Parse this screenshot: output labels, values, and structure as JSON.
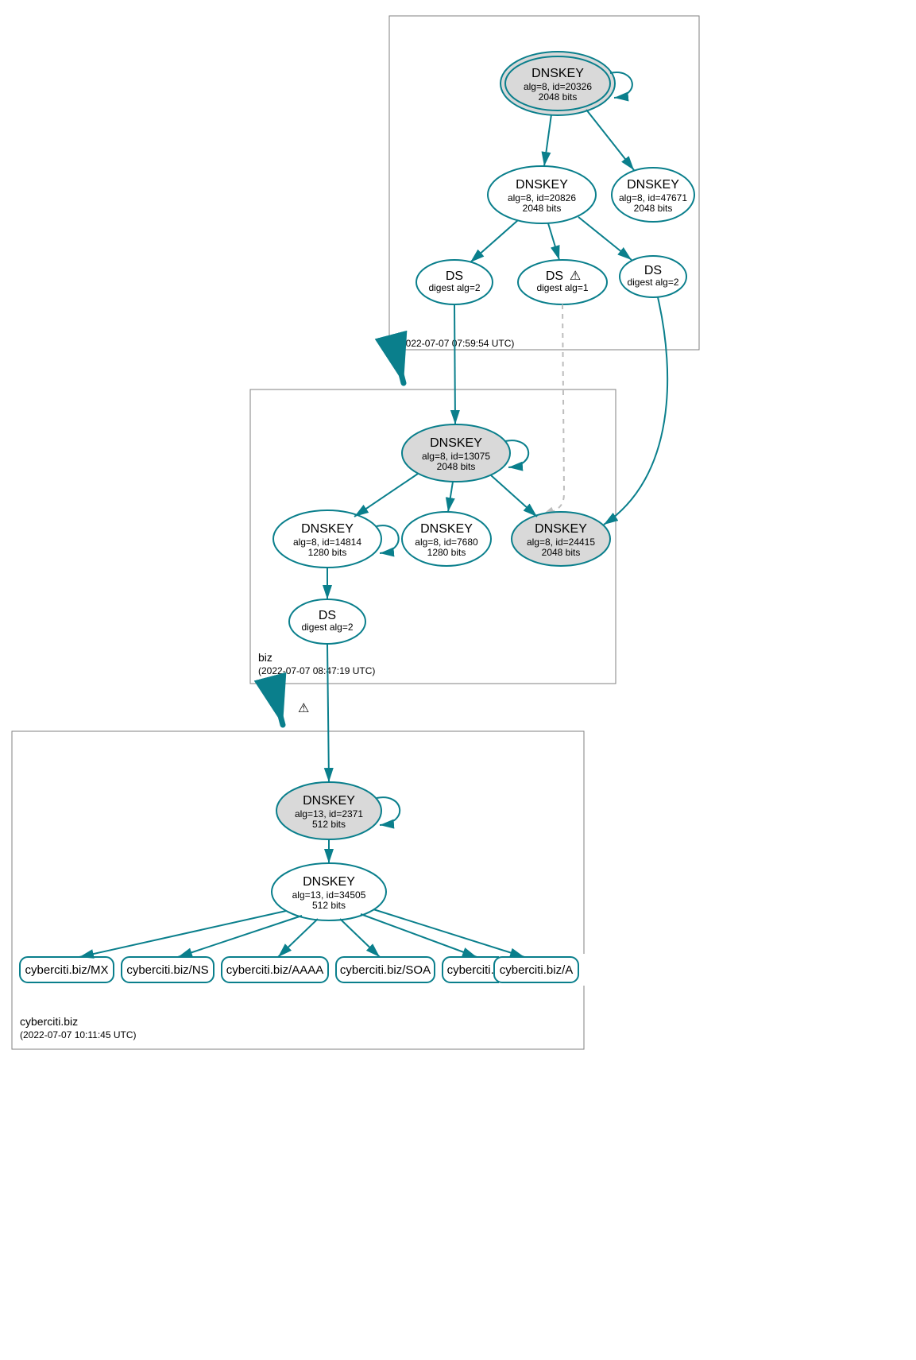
{
  "zones": {
    "root": {
      "name": ".",
      "timestamp": "(2022-07-07 07:59:54 UTC)"
    },
    "biz": {
      "name": "biz",
      "timestamp": "(2022-07-07 08:47:19 UTC)"
    },
    "cyberciti": {
      "name": "cyberciti.biz",
      "timestamp": "(2022-07-07 10:11:45 UTC)"
    }
  },
  "nodes": {
    "root_ksk": {
      "title": "DNSKEY",
      "line2": "alg=8, id=20326",
      "line3": "2048 bits"
    },
    "root_zsk1": {
      "title": "DNSKEY",
      "line2": "alg=8, id=20826",
      "line3": "2048 bits"
    },
    "root_zsk2": {
      "title": "DNSKEY",
      "line2": "alg=8, id=47671",
      "line3": "2048 bits"
    },
    "root_ds1": {
      "title": "DS",
      "line2": "digest alg=2",
      "line3": ""
    },
    "root_ds2": {
      "title": "DS",
      "line2": "digest alg=1",
      "line3": "",
      "warn": true
    },
    "root_ds3": {
      "title": "DS",
      "line2": "digest alg=2",
      "line3": ""
    },
    "biz_ksk": {
      "title": "DNSKEY",
      "line2": "alg=8, id=13075",
      "line3": "2048 bits"
    },
    "biz_zsk1": {
      "title": "DNSKEY",
      "line2": "alg=8, id=14814",
      "line3": "1280 bits"
    },
    "biz_zsk2": {
      "title": "DNSKEY",
      "line2": "alg=8, id=7680",
      "line3": "1280 bits"
    },
    "biz_zsk3": {
      "title": "DNSKEY",
      "line2": "alg=8, id=24415",
      "line3": "2048 bits"
    },
    "biz_ds": {
      "title": "DS",
      "line2": "digest alg=2",
      "line3": ""
    },
    "cy_ksk": {
      "title": "DNSKEY",
      "line2": "alg=13, id=2371",
      "line3": "512 bits"
    },
    "cy_zsk": {
      "title": "DNSKEY",
      "line2": "alg=13, id=34505",
      "line3": "512 bits"
    }
  },
  "rrsets": {
    "mx": "cyberciti.biz/MX",
    "ns": "cyberciti.biz/NS",
    "aaaa": "cyberciti.biz/AAAA",
    "soa": "cyberciti.biz/SOA",
    "txt": "cyberciti.biz/TXT",
    "a": "cyberciti.biz/A"
  },
  "warn_glyph": "⚠"
}
